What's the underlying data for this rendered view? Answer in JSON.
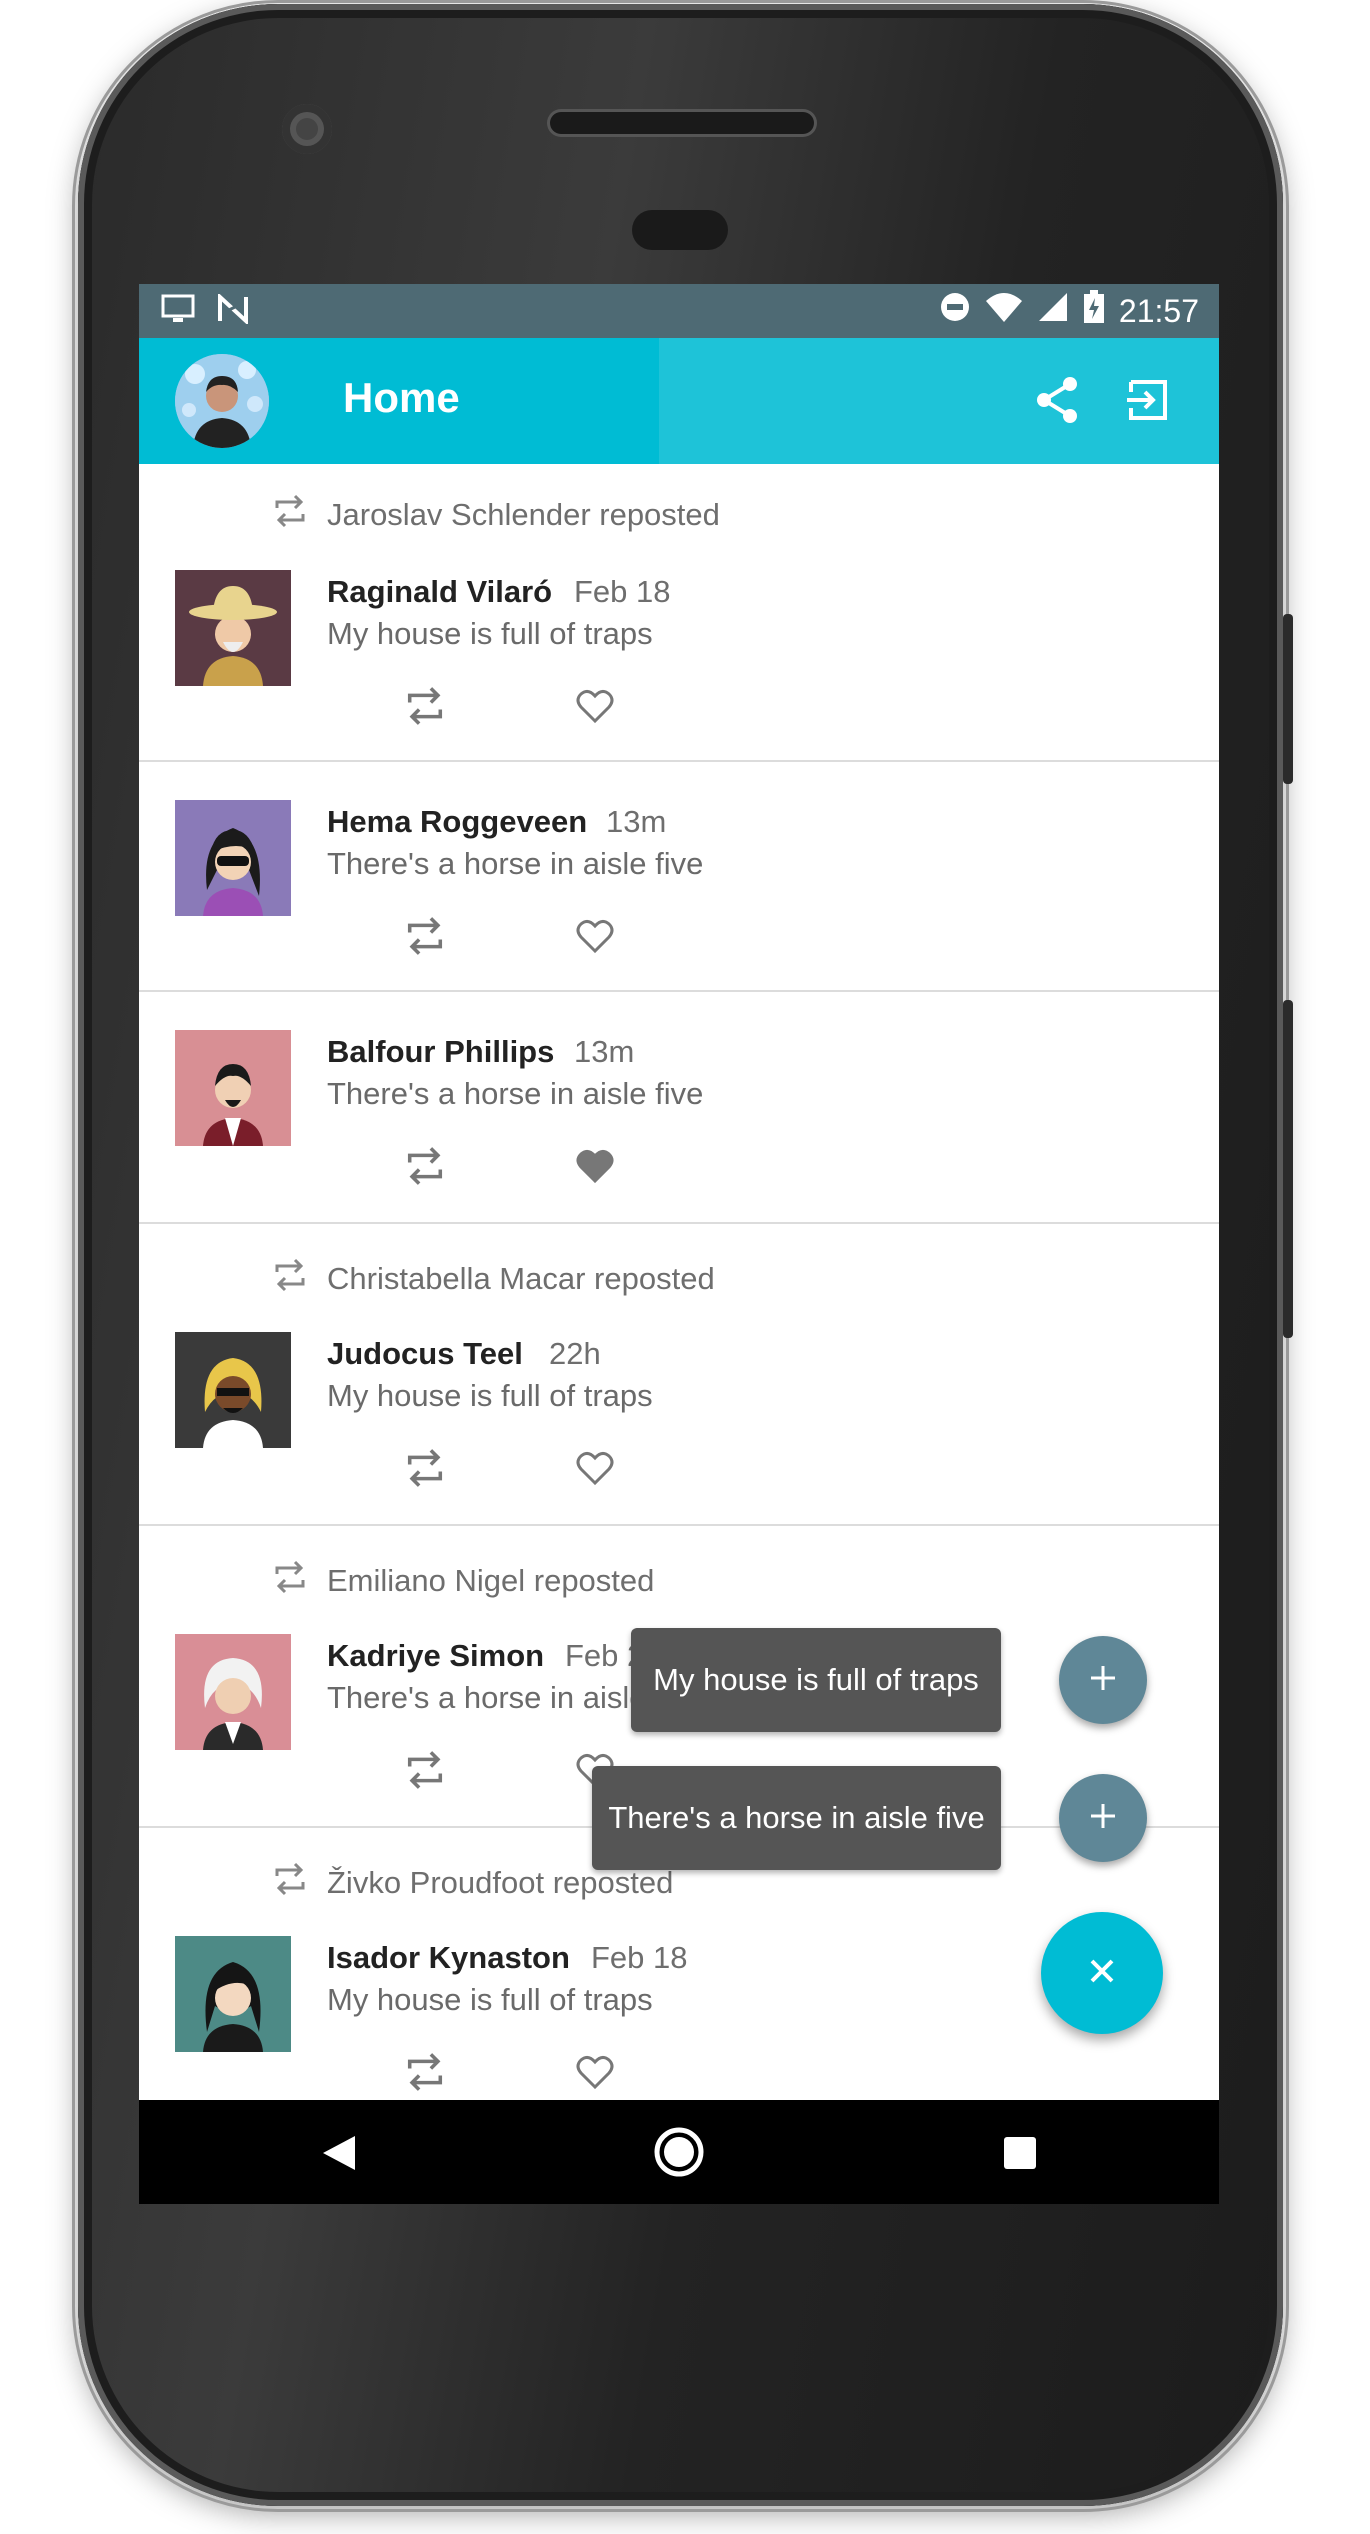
{
  "status_bar": {
    "time": "21:57",
    "left_icons": [
      "desktop-icon",
      "n-logo-icon"
    ],
    "right_icons": [
      "do-not-disturb-icon",
      "wifi-icon",
      "signal-icon",
      "battery-charging-icon"
    ]
  },
  "toolbar": {
    "title": "Home",
    "share_icon": "share-icon",
    "logout_icon": "exit-to-app-icon"
  },
  "colors": {
    "accent": "#00bcd4",
    "status_bar": "#4e6a74",
    "mini_fab": "#5f8797",
    "label_bg": "#555555",
    "text_secondary": "#6e6e6e"
  },
  "feed": {
    "posts": [
      {
        "reposted_by": "Jaroslav Schlender reposted",
        "name": "Raginald Vilaró",
        "time": "Feb 18",
        "text": "My house is full of traps",
        "liked": false
      },
      {
        "reposted_by": "",
        "name": "Hema Roggeveen",
        "time": "13m",
        "text": "There's a horse in aisle five",
        "liked": false
      },
      {
        "reposted_by": "",
        "name": "Balfour Phillips",
        "time": "13m",
        "text": "There's a horse in aisle five",
        "liked": true
      },
      {
        "reposted_by": "Christabella Macar reposted",
        "name": "Judocus Teel",
        "time": "22h",
        "text": "My house is full of traps",
        "liked": false
      },
      {
        "reposted_by": "Emiliano Nigel reposted",
        "name": "Kadriye Simon",
        "time": "Feb 20",
        "text": "There's a horse in aisle five",
        "liked": false
      },
      {
        "reposted_by": "Živko Proudfoot reposted",
        "name": "Isador Kynaston",
        "time": "Feb 18",
        "text": "My house is full of traps",
        "liked": false
      }
    ]
  },
  "fab_menu": {
    "items": [
      {
        "label": "My house is full of traps",
        "icon": "plus-icon"
      },
      {
        "label": "There's a horse in aisle five",
        "icon": "plus-icon"
      }
    ],
    "close_icon": "close-icon"
  },
  "nav_bar": {
    "buttons": [
      "back-icon",
      "home-icon",
      "recents-icon"
    ]
  }
}
